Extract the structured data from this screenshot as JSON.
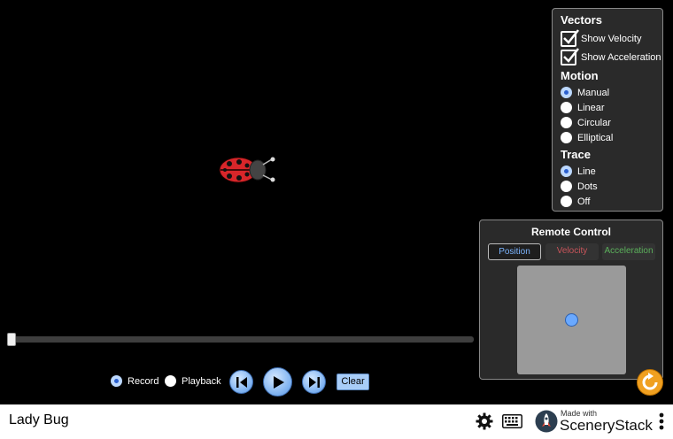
{
  "vectors": {
    "heading": "Vectors",
    "show_velocity": {
      "label": "Show Velocity",
      "checked": true
    },
    "show_acceleration": {
      "label": "Show Acceleration",
      "checked": true
    }
  },
  "motion": {
    "heading": "Motion",
    "options": [
      {
        "label": "Manual",
        "selected": true
      },
      {
        "label": "Linear",
        "selected": false
      },
      {
        "label": "Circular",
        "selected": false
      },
      {
        "label": "Elliptical",
        "selected": false
      }
    ]
  },
  "trace": {
    "heading": "Trace",
    "options": [
      {
        "label": "Line",
        "selected": true
      },
      {
        "label": "Dots",
        "selected": false
      },
      {
        "label": "Off",
        "selected": false
      }
    ]
  },
  "remote_control": {
    "title": "Remote Control",
    "tabs": [
      {
        "label": "Position",
        "selected": true
      },
      {
        "label": "Velocity",
        "selected": false
      },
      {
        "label": "Acceleration",
        "selected": false
      }
    ]
  },
  "playback": {
    "record_label": "Record",
    "playback_label": "Playback",
    "mode": "Record",
    "clear_label": "Clear",
    "time_progress": 0
  },
  "nav": {
    "title": "Lady Bug",
    "made_with": "Made with",
    "brand": "SceneryStack"
  },
  "colors": {
    "position": "#7bb4ff",
    "velocity": "#c8545a",
    "acceleration": "#5bb05b",
    "reset": "#f0a020"
  },
  "icons": [
    "ladybug-icon",
    "checkmark-icon",
    "step-back-icon",
    "play-icon",
    "step-forward-icon",
    "reset-icon",
    "gear-icon",
    "keyboard-icon",
    "rocket-icon",
    "kebab-menu-icon"
  ]
}
